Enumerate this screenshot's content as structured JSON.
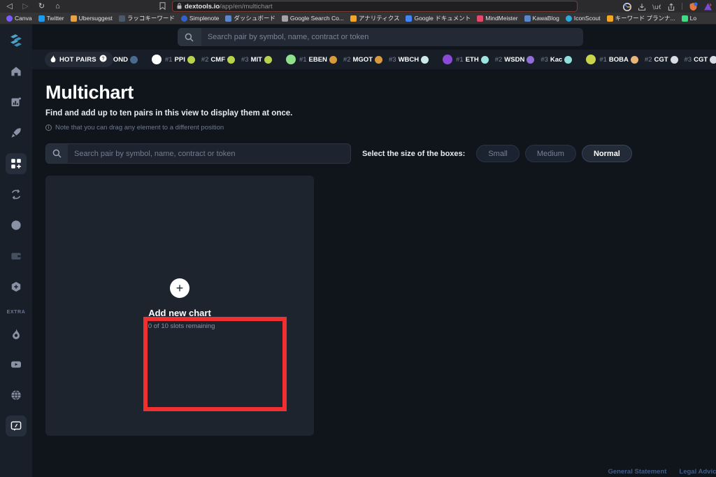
{
  "browser": {
    "nav": {
      "back": "◁",
      "forward": "▷",
      "reload": "↻",
      "home": "⌂"
    },
    "reader_icon": "☐",
    "lock_icon": "ὑ2",
    "url_domain": "dextools.io",
    "url_path": "/app/en/multichart",
    "bookmarks": [
      {
        "label": "Canva",
        "color": "#7d5cff",
        "icon": "canva-icon"
      },
      {
        "label": "Twitter",
        "color": "#1d9bf0",
        "icon": "twitter-icon"
      },
      {
        "label": "Ubersuggest",
        "color": "#e8a33d",
        "icon": "ubersuggest-icon"
      },
      {
        "label": "ラッコキーワード",
        "color": "#4a5a6a",
        "icon": "rakko-icon"
      },
      {
        "label": "Simplenote",
        "color": "#3361cc",
        "icon": "simplenote-icon"
      },
      {
        "label": "ダッシュボード",
        "color": "#5b86c9",
        "icon": "dashboard-icon"
      },
      {
        "label": "Google Search Co...",
        "color": "#a3a3a8",
        "icon": "google-search-console-icon"
      },
      {
        "label": "アナリティクス",
        "color": "#f5a623",
        "icon": "analytics-icon"
      },
      {
        "label": "Google ドキュメント",
        "color": "#4285f4",
        "icon": "google-docs-icon"
      },
      {
        "label": "MindMeister",
        "color": "#e4486b",
        "icon": "mindmeister-icon"
      },
      {
        "label": "KawaBlog",
        "color": "#5b86c9",
        "icon": "kawablog-icon"
      },
      {
        "label": "IconScout",
        "color": "#29abe2",
        "icon": "iconscout-icon"
      },
      {
        "label": "キーワード プランナ...",
        "color": "#f5a623",
        "icon": "keyword-planner-icon"
      },
      {
        "label": "Lo",
        "color": "#3ddc84",
        "icon": "lo-icon"
      }
    ]
  },
  "sidebar": {
    "logo_name": "dextools-logo",
    "items": [
      {
        "name": "sidebar-item-home",
        "icon": "home-icon",
        "state": "default"
      },
      {
        "name": "sidebar-item-charts",
        "icon": "bar-chart-icon",
        "state": "default"
      },
      {
        "name": "sidebar-item-gainers",
        "icon": "rocket-icon",
        "state": "default"
      },
      {
        "name": "sidebar-item-multichart",
        "icon": "grid-plus-icon",
        "state": "active"
      },
      {
        "name": "sidebar-item-swap",
        "icon": "swap-arrows-icon",
        "state": "default"
      },
      {
        "name": "sidebar-item-analytics",
        "icon": "pie-chart-icon",
        "state": "default"
      },
      {
        "name": "sidebar-item-wallet",
        "icon": "wallet-icon",
        "state": "disabled"
      },
      {
        "name": "sidebar-item-add",
        "icon": "plus-circle-icon",
        "state": "default"
      }
    ],
    "extra_label": "EXTRA",
    "extra_items": [
      {
        "name": "sidebar-item-hot",
        "icon": "flame-icon",
        "state": "default"
      },
      {
        "name": "sidebar-item-video",
        "icon": "youtube-icon",
        "state": "default"
      },
      {
        "name": "sidebar-item-language",
        "icon": "globe-icon",
        "state": "default"
      },
      {
        "name": "sidebar-item-feedback",
        "icon": "feedback-icon",
        "state": "active"
      }
    ]
  },
  "topbar": {
    "search_placeholder": "Search pair by symbol, name, contract or token",
    "search_value": "",
    "search_icon": "search-icon"
  },
  "ticker": {
    "hot_label": "HOT PAIRS",
    "flame_icon": "flame-icon",
    "help_icon": "question-mark-icon",
    "groups": [
      {
        "chain": "partial-left",
        "chain_color": "#4a6b8f",
        "items": [
          {
            "rank": "",
            "symbol": "OND",
            "token_color": "#4a6b8f"
          }
        ]
      },
      {
        "chain": "harmony",
        "chain_color": "#ffffff",
        "items": [
          {
            "rank": "#1",
            "symbol": "PPI",
            "token_color": "#b9d24d"
          },
          {
            "rank": "#2",
            "symbol": "CMF",
            "token_color": "#b9d24d"
          },
          {
            "rank": "#3",
            "symbol": "MIT",
            "token_color": "#b9d24d"
          }
        ]
      },
      {
        "chain": "eben-chain",
        "chain_color": "#8ee08a",
        "items": [
          {
            "rank": "#1",
            "symbol": "EBEN",
            "token_color": "#d79a3c"
          },
          {
            "rank": "#2",
            "symbol": "MGOT",
            "token_color": "#d79a3c"
          },
          {
            "rank": "#3",
            "symbol": "WBCH",
            "token_color": "#cfe8e8"
          }
        ]
      },
      {
        "chain": "ethereum",
        "chain_color": "#8a4ad6",
        "items": [
          {
            "rank": "#1",
            "symbol": "ETH",
            "token_color": "#9fe4e0"
          },
          {
            "rank": "#2",
            "symbol": "WSDN",
            "token_color": "#8f6fd6"
          },
          {
            "rank": "#3",
            "symbol": "Kac",
            "token_color": "#8fe0dc"
          }
        ]
      },
      {
        "chain": "boba",
        "chain_color": "#c8d44a",
        "items": [
          {
            "rank": "#1",
            "symbol": "BOBA",
            "token_color": "#e8b57a"
          },
          {
            "rank": "#2",
            "symbol": "CGT",
            "token_color": "#d8dce4"
          },
          {
            "rank": "#3",
            "symbol": "CGT",
            "token_color": "#d8dce4"
          }
        ]
      },
      {
        "chain": "partial-right",
        "chain_color": "#ffffff",
        "items": []
      }
    ]
  },
  "main": {
    "title": "Multichart",
    "subtitle": "Find and add up to ten pairs in this view to display them at once.",
    "note_icon": "info-icon",
    "note": "Note that you can drag any element to a different position",
    "pair_search": {
      "placeholder": "Search pair by symbol, name, contract or token",
      "value": "",
      "icon": "search-icon"
    },
    "size_selector": {
      "label": "Select the size of the boxes:",
      "options": [
        "Small",
        "Medium",
        "Normal"
      ],
      "selected": "Normal"
    },
    "add_card": {
      "plus_icon": "plus-icon",
      "title": "Add new chart",
      "subtitle": "10 of 10 slots remaining"
    },
    "highlight_color": "#f03030"
  },
  "footer": {
    "links": [
      "General Statement",
      "Legal Advice"
    ]
  }
}
